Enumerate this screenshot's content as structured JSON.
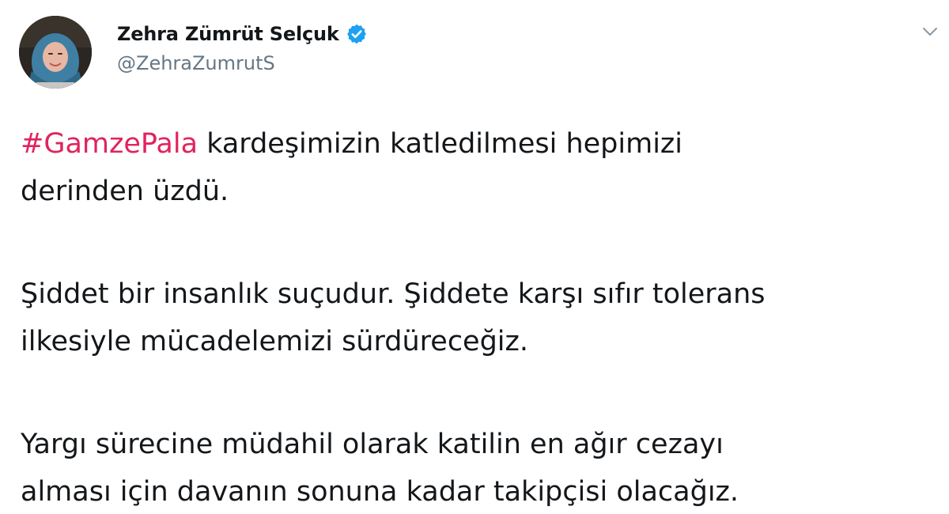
{
  "author": {
    "display_name": "Zehra Zümrüt Selçuk",
    "handle": "@ZehraZumrutS",
    "verified": true,
    "avatar_icon": "profile-photo"
  },
  "menu_icon": "chevron-down-icon",
  "tweet": {
    "hashtag": "#GamzePala",
    "para1_line1_rest": " kardeşimizin katledilmesi hepimizi",
    "para1_line2": "derinden üzdü.",
    "para2_line1": "Şiddet bir insanlık suçudur. Şiddete karşı sıfır tolerans",
    "para2_line2": "ilkesiyle mücadelemizi sürdüreceğiz.",
    "para3_line1": "Yargı sürecine müdahil olarak katilin en ağır cezayı",
    "para3_line2": "alması için davanın sonuna kadar takipçisi olacağız."
  },
  "colors": {
    "hashtag": "#e0245e",
    "verified_badge": "#1da1f2",
    "handle": "#657786",
    "text": "#14171a"
  }
}
